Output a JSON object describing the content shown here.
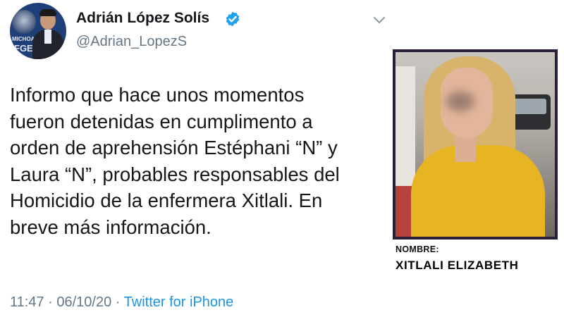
{
  "author": {
    "display_name": "Adrián López Solís",
    "handle": "@Adrian_LopezS",
    "avatar_badge_text": "MICHOACÁN",
    "avatar_badge_abbr": "FGE"
  },
  "tweet": {
    "text": "Informo que hace unos momentos\nfueron detenidas en cumplimento a\norden de aprehensión  Estéphani “N” y\nLaura “N”, probables responsables del\nHomicidio de la enfermera Xitlali. En\nbreve más información."
  },
  "media": {
    "caption_label": "NOMBRE:",
    "caption_name": "XITLALI ELIZABETH"
  },
  "meta": {
    "time": "11:47",
    "separator": "·",
    "date": "06/10/20",
    "source": "Twitter for iPhone"
  },
  "colors": {
    "verified": "#1da1f2",
    "link": "#1b95e0",
    "secondary_text": "#657786",
    "photo_frame": "#2b1f3a"
  },
  "icons": [
    "verified-badge-icon",
    "chevron-down-icon"
  ]
}
